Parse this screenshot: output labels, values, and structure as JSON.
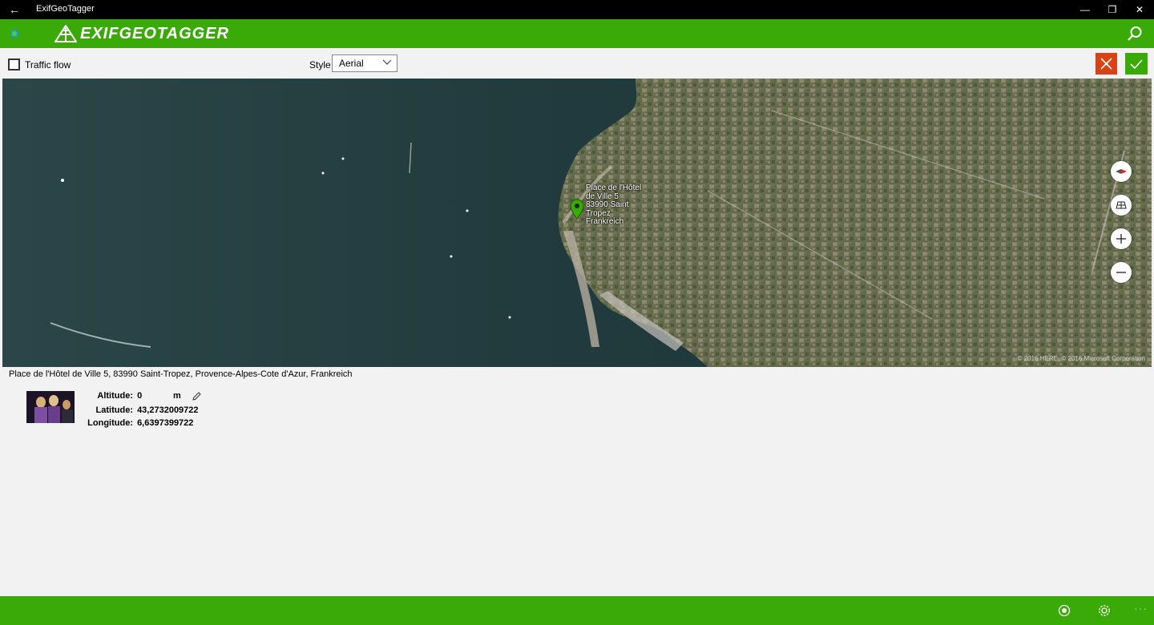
{
  "window": {
    "title": "ExifGeoTagger",
    "back_glyph": "←",
    "minimize_glyph": "—",
    "maximize_glyph": "❐",
    "close_glyph": "✕"
  },
  "header": {
    "logo_text": "EXIFGEOTAGGER",
    "icons": [
      "status-dot-icon",
      "search-icon"
    ]
  },
  "toolbar": {
    "traffic_label": "Traffic flow",
    "traffic_checked": false,
    "style_label": "Style",
    "style_value": "Aerial",
    "cancel_icon": "close-icon",
    "confirm_icon": "checkmark-icon"
  },
  "map": {
    "pin_label": "Place de l'Hôtel de Ville 5 83990 Saint Tropez Frankreich",
    "copyright": "© 2016 HERE, © 2016 Microsoft Corporation",
    "controls": [
      "compass-icon",
      "map-style-icon",
      "zoom-in-icon",
      "zoom-out-icon"
    ]
  },
  "location": {
    "address": "Place de l'Hôtel de Ville 5, 83990 Saint-Tropez, Provence-Alpes-Cote d'Azur, Frankreich",
    "altitude_label": "Altitude:",
    "altitude_value": "0",
    "altitude_unit": "m",
    "latitude_label": "Latitude:",
    "latitude_value": "43,2732009722",
    "longitude_label": "Longitude:",
    "longitude_value": "6,6397399722"
  },
  "bottombar": {
    "more_glyph": "···",
    "icons": [
      "record-icon",
      "settings-icon",
      "more-icon"
    ]
  },
  "colors": {
    "accent_green": "#3aaa08",
    "cancel_red": "#d84315"
  }
}
